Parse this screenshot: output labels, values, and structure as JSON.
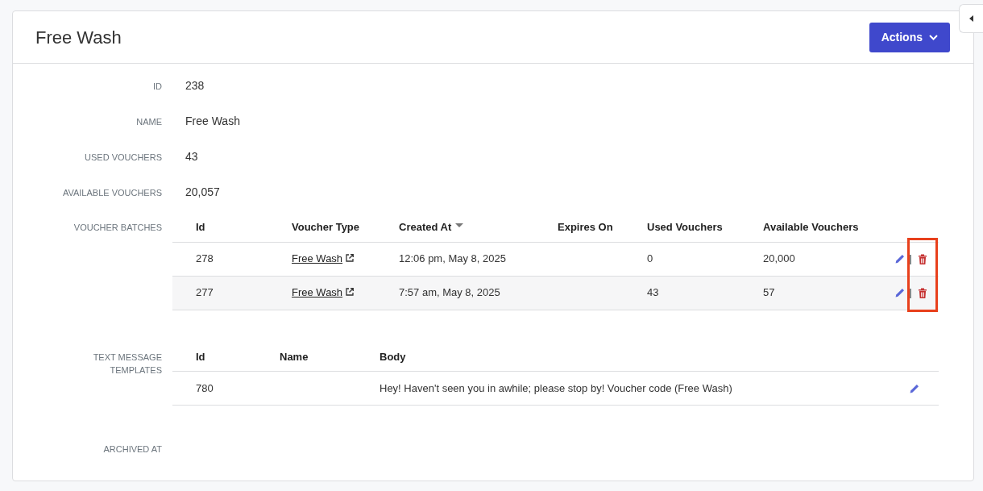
{
  "title": "Free Wash",
  "actions_button": {
    "label": "Actions"
  },
  "fields": [
    {
      "label": "ID",
      "value": "238"
    },
    {
      "label": "NAME",
      "value": "Free Wash"
    },
    {
      "label": "USED VOUCHERS",
      "value": "43"
    },
    {
      "label": "AVAILABLE VOUCHERS",
      "value": "20,057"
    }
  ],
  "voucher_batches": {
    "label": "VOUCHER BATCHES",
    "columns": [
      {
        "label": "Id",
        "sorted": false
      },
      {
        "label": "Voucher Type",
        "sorted": false
      },
      {
        "label": "Created At",
        "sorted": true
      },
      {
        "label": "Expires On",
        "sorted": false
      },
      {
        "label": "Used Vouchers",
        "sorted": false
      },
      {
        "label": "Available Vouchers",
        "sorted": false
      }
    ],
    "rows": [
      {
        "id": "278",
        "voucher_type": "Free Wash",
        "created_at": "12:06 pm, May 8, 2025",
        "used": "0",
        "available": "20,000"
      },
      {
        "id": "277",
        "voucher_type": "Free Wash",
        "created_at": "7:57 am, May 8, 2025",
        "used": "43",
        "available": "57"
      }
    ],
    "delete_highlighted": true
  },
  "text_message_templates": {
    "label": "TEXT MESSAGE TEMPLATES",
    "columns": [
      "Id",
      "Name",
      "Body"
    ],
    "rows": [
      {
        "id": "780",
        "body": "Hey! Haven't seen you in awhile; please stop by! Voucher code (Free Wash)"
      }
    ]
  },
  "archived_at": {
    "label": "ARCHIVED AT"
  }
}
